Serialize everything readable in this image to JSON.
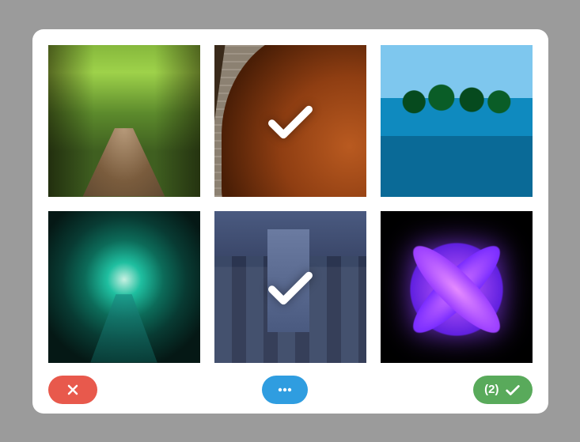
{
  "grid": {
    "tiles": [
      {
        "name": "forest-path",
        "icon": "forest-icon",
        "selected": false
      },
      {
        "name": "violin-music",
        "icon": "violin-icon",
        "selected": true
      },
      {
        "name": "tropical-pool",
        "icon": "pool-icon",
        "selected": false
      },
      {
        "name": "tree-tunnel",
        "icon": "tunnel-icon",
        "selected": false
      },
      {
        "name": "city-night",
        "icon": "city-icon",
        "selected": true
      },
      {
        "name": "purple-lotus",
        "icon": "lotus-icon",
        "selected": false
      }
    ]
  },
  "toolbar": {
    "cancel_label": "",
    "more_label": "",
    "selected_count_label": "(2)"
  },
  "colors": {
    "cancel": "#e8594c",
    "more": "#2f9de0",
    "confirm": "#59aa5b"
  }
}
